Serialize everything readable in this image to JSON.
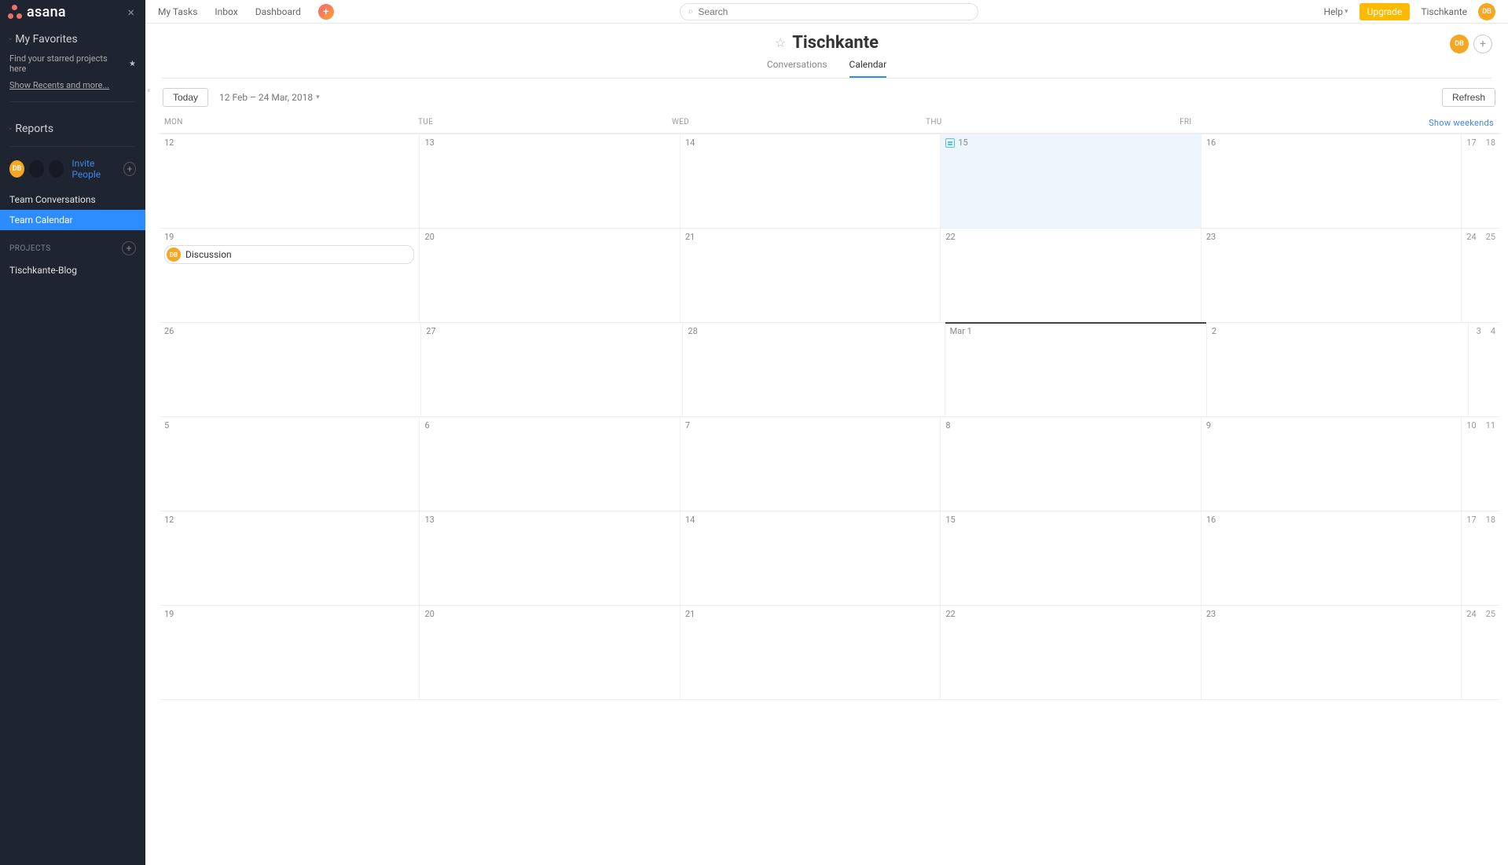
{
  "logo": {
    "text": "asana"
  },
  "sidebar": {
    "favorites_title": "My Favorites",
    "favorites_hint": "Find your starred projects here",
    "show_recents": "Show Recents and more...",
    "reports_title": "Reports",
    "invite_label": "Invite People",
    "avatar_initials": "DB",
    "team_items": [
      {
        "label": "Team Conversations"
      },
      {
        "label": "Team Calendar"
      }
    ],
    "projects_label": "PROJECTS",
    "projects": [
      {
        "label": "Tischkante-Blog"
      }
    ]
  },
  "topnav": {
    "links": [
      {
        "label": "My Tasks"
      },
      {
        "label": "Inbox"
      },
      {
        "label": "Dashboard"
      }
    ],
    "search_placeholder": "Search",
    "help_label": "Help",
    "upgrade_label": "Upgrade",
    "team_label": "Tischkante",
    "avatar_initials": "DB"
  },
  "page": {
    "title": "Tischkante",
    "tabs": [
      {
        "label": "Conversations"
      },
      {
        "label": "Calendar"
      }
    ],
    "avatar_initials": "DB"
  },
  "calendar": {
    "today_btn": "Today",
    "range": "12 Feb – 24 Mar, 2018",
    "refresh_btn": "Refresh",
    "show_weekends": "Show weekends",
    "dow": [
      "MON",
      "TUE",
      "WED",
      "THU",
      "FRI"
    ],
    "event_label": "Discussion",
    "event_initials": "DB",
    "weeks": [
      {
        "days": [
          "12",
          "13",
          "14",
          "15",
          "16"
        ],
        "weekend": [
          "17",
          "18"
        ],
        "today_idx": 3
      },
      {
        "days": [
          "19",
          "20",
          "21",
          "22",
          "23"
        ],
        "weekend": [
          "24",
          "25"
        ],
        "event_idx": 0
      },
      {
        "days": [
          "26",
          "27",
          "28",
          "Mar 1",
          "2"
        ],
        "weekend": [
          "3",
          "4"
        ],
        "month_bar_idx": 3
      },
      {
        "days": [
          "5",
          "6",
          "7",
          "8",
          "9"
        ],
        "weekend": [
          "10",
          "11"
        ]
      },
      {
        "days": [
          "12",
          "13",
          "14",
          "15",
          "16"
        ],
        "weekend": [
          "17",
          "18"
        ]
      },
      {
        "days": [
          "19",
          "20",
          "21",
          "22",
          "23"
        ],
        "weekend": [
          "24",
          "25"
        ]
      }
    ]
  }
}
